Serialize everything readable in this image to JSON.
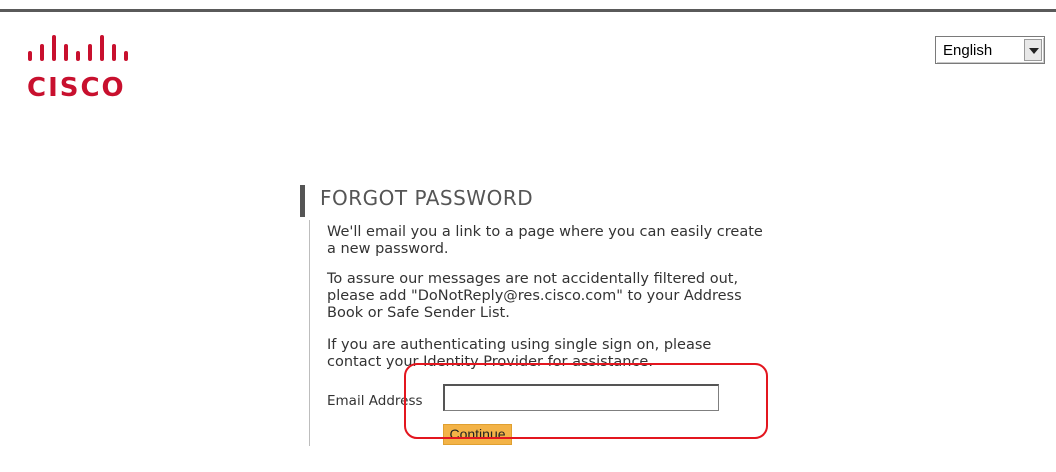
{
  "header": {
    "logo": {
      "icon": "cisco-bridge-logo",
      "wordmark": "CISCO",
      "brand_color": "#c8102e"
    },
    "language_select": {
      "selected": "English"
    }
  },
  "forgot_password": {
    "title": "FORGOT PASSWORD",
    "paragraphs": [
      "We'll email you a link to a page where you can easily create a new password.",
      "To assure our messages are not accidentally filtered out, please add \"DoNotReply@res.cisco.com\" to your Address Book or Safe Sender List.",
      "If you are authenticating using single sign on, please contact your Identity Provider for assistance."
    ],
    "email_label": "Email Address",
    "email_value": "",
    "continue_label": "Continue",
    "continue_color": "#f3b347"
  },
  "annotation": {
    "highlight_color": "#e3161f"
  }
}
